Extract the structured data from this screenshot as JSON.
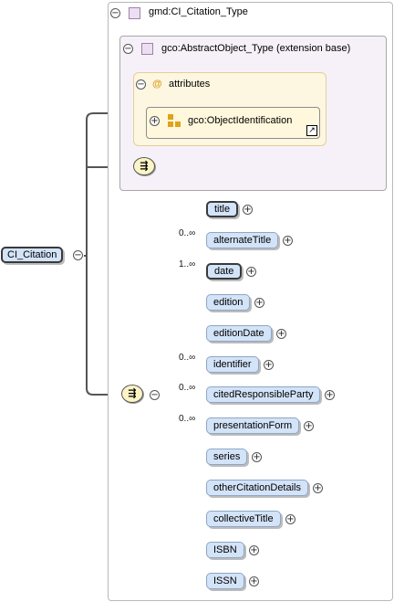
{
  "root_element": {
    "label": "CI_Citation"
  },
  "complex_type": {
    "label": "gmd:CI_Citation_Type"
  },
  "extension": {
    "label": "gco:AbstractObject_Type (extension base)"
  },
  "attributes": {
    "label": "attributes",
    "icon": "at-sign-icon"
  },
  "attribute_group": {
    "label": "gco:ObjectIdentification",
    "icon": "attribute-group-icon"
  },
  "collapse_symbol": "−",
  "expand_symbol": "+",
  "sequence": {
    "children": [
      {
        "label": "title",
        "cardinality": "",
        "required": true
      },
      {
        "label": "alternateTitle",
        "cardinality": "0..∞",
        "required": false
      },
      {
        "label": "date",
        "cardinality": "1..∞",
        "required": true
      },
      {
        "label": "edition",
        "cardinality": "",
        "required": false
      },
      {
        "label": "editionDate",
        "cardinality": "",
        "required": false
      },
      {
        "label": "identifier",
        "cardinality": "0..∞",
        "required": false
      },
      {
        "label": "citedResponsibleParty",
        "cardinality": "0..∞",
        "required": false
      },
      {
        "label": "presentationForm",
        "cardinality": "0..∞",
        "required": false
      },
      {
        "label": "series",
        "cardinality": "",
        "required": false
      },
      {
        "label": "otherCitationDetails",
        "cardinality": "",
        "required": false
      },
      {
        "label": "collectiveTitle",
        "cardinality": "",
        "required": false
      },
      {
        "label": "ISBN",
        "cardinality": "",
        "required": false
      },
      {
        "label": "ISSN",
        "cardinality": "",
        "required": false
      }
    ]
  },
  "colors": {
    "element_fill": "#d3e3f8",
    "attributes_fill": "#fdf6e0",
    "extension_fill": "#f6f1f8",
    "sequence_fill": "#fbf4c4",
    "connector": "#555555"
  }
}
